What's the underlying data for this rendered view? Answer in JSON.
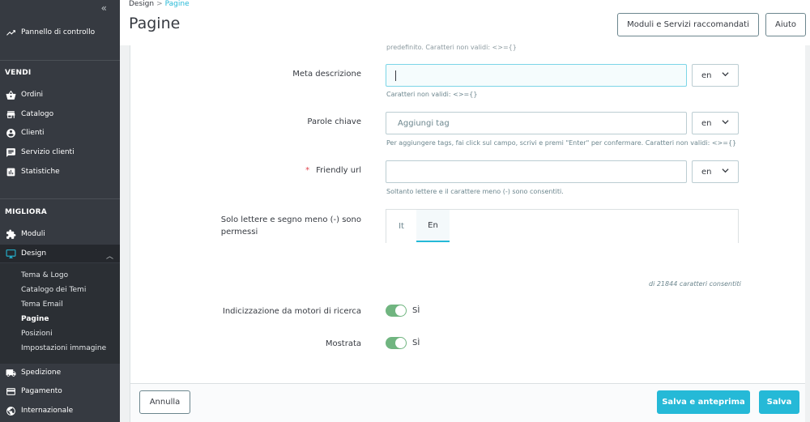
{
  "sidebar": {
    "collapse_label": "«",
    "dashboard": {
      "label": "Pannello di controllo",
      "icon": "trending-up-icon"
    },
    "sections": {
      "sell": "VENDI",
      "improve": "MIGLIORA"
    },
    "sell_items": [
      {
        "label": "Ordini",
        "icon": "basket-icon"
      },
      {
        "label": "Catalogo",
        "icon": "store-icon"
      },
      {
        "label": "Clienti",
        "icon": "account-circle-icon"
      },
      {
        "label": "Servizio clienti",
        "icon": "chat-icon"
      },
      {
        "label": "Statistiche",
        "icon": "bar-chart-icon"
      }
    ],
    "improve_items": [
      {
        "label": "Moduli",
        "icon": "puzzle-icon"
      },
      {
        "label": "Design",
        "icon": "desktop-icon"
      }
    ],
    "design_subitems": [
      {
        "label": "Tema & Logo"
      },
      {
        "label": "Catalogo dei Temi"
      },
      {
        "label": "Tema Email"
      },
      {
        "label": "Pagine",
        "active": true
      },
      {
        "label": "Posizioni"
      },
      {
        "label": "Impostazioni immagine"
      }
    ],
    "bottom_items": [
      {
        "label": "Spedizione",
        "icon": "truck-icon"
      },
      {
        "label": "Pagamento",
        "icon": "credit-card-icon"
      },
      {
        "label": "Internazionale",
        "icon": "globe-icon"
      }
    ]
  },
  "header": {
    "breadcrumb": {
      "parent": "Design",
      "separator": ">",
      "current": "Pagine"
    },
    "title": "Pagine",
    "recommended_button": "Moduli e Servizi raccomandati",
    "help_button": "Aiuto"
  },
  "form": {
    "top_help_partial": "predefinito. Caratteri non validi: <>={}",
    "meta_description": {
      "label": "Meta descrizione",
      "value": "",
      "lang": "en",
      "help": "Caratteri non validi: <>={}"
    },
    "keywords": {
      "label": "Parole chiave",
      "placeholder": "Aggiungi tag",
      "lang": "en",
      "help": "Per aggiungere tags, fai click sul campo, scrivi e premi \"Enter\" per confermare. Caratteri non validi: <>={}"
    },
    "friendly_url": {
      "required_mark": "*",
      "label": "Friendly url",
      "value": "",
      "lang": "en",
      "help": "Soltanto lettere e il carattere meno (-) sono consentiti."
    },
    "content": {
      "label_line1": "Solo lettere e segno meno (-) sono",
      "label_line2": "permessi",
      "tabs": [
        "It",
        "En"
      ],
      "active_tab": "En",
      "counter": "di 21844 caratteri consentiti"
    },
    "indexing": {
      "label": "Indicizzazione da motori di ricerca",
      "state": "SÌ",
      "on": true
    },
    "displayed": {
      "label": "Mostrata",
      "state": "SÌ",
      "on": true
    }
  },
  "footer": {
    "cancel": "Annulla",
    "save_preview": "Salva e anteprima",
    "save": "Salva"
  },
  "colors": {
    "accent": "#25b9d7",
    "sidebar_bg": "#363a41",
    "toggle_on": "#70b580"
  }
}
